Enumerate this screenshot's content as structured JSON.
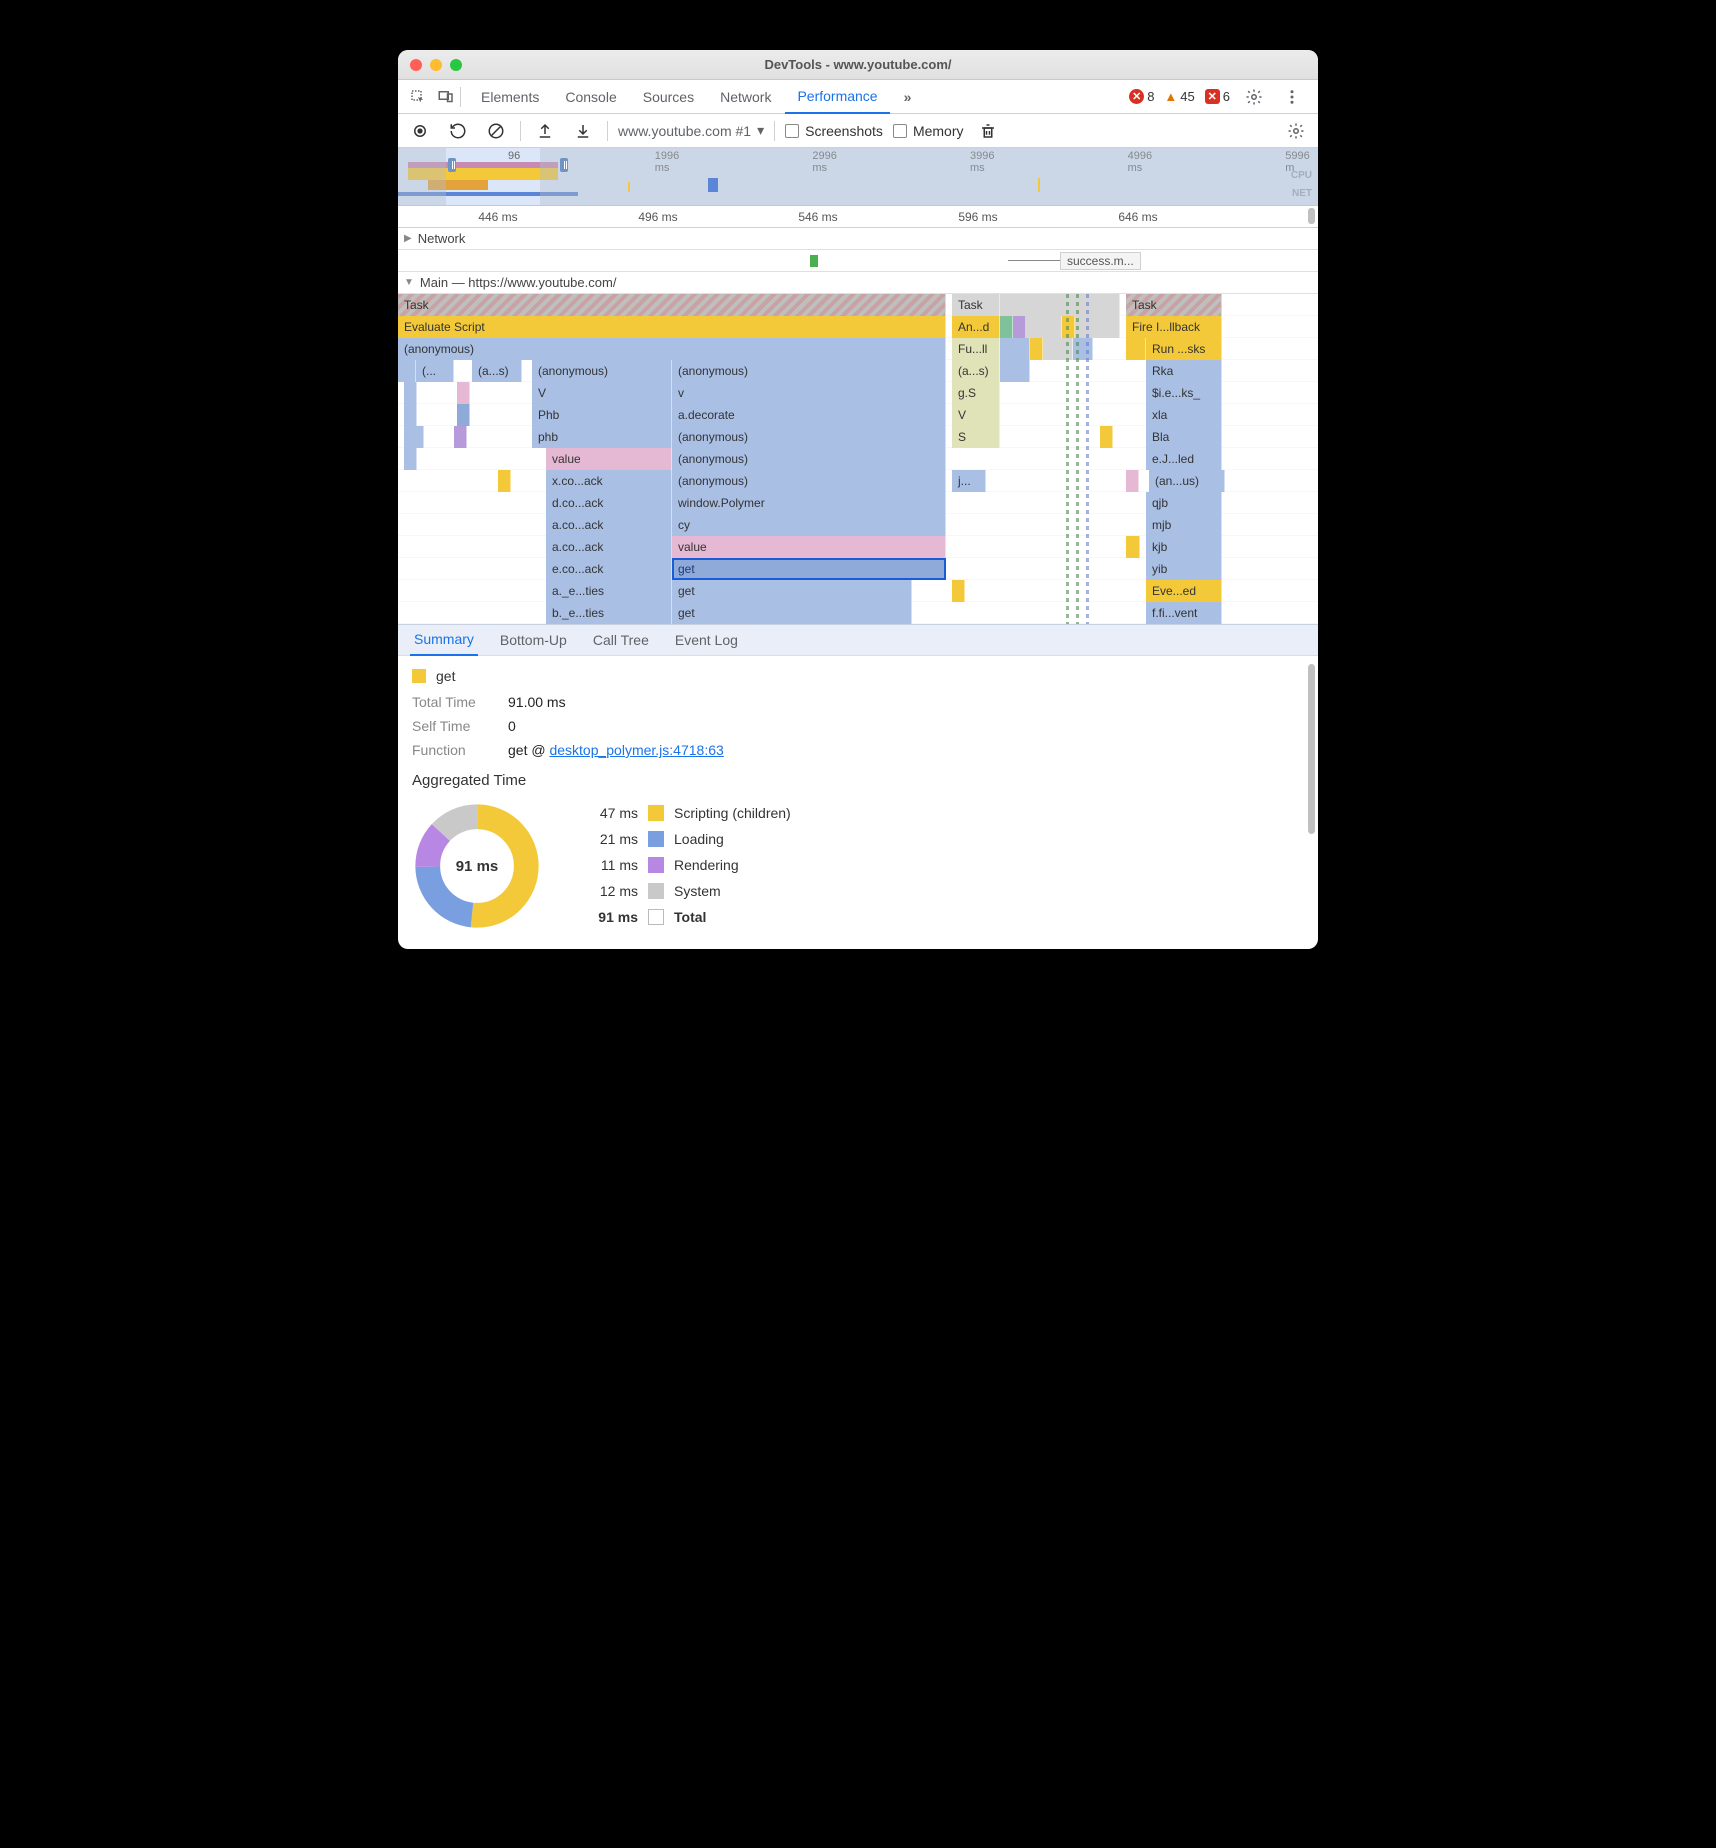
{
  "window": {
    "title": "DevTools - www.youtube.com/"
  },
  "mainTabs": {
    "items": [
      "Elements",
      "Console",
      "Sources",
      "Network",
      "Performance"
    ],
    "activeIndex": 4,
    "overflow": "»"
  },
  "statusBadges": {
    "errors": "8",
    "warnings": "45",
    "issues": "6"
  },
  "subToolbar": {
    "recording": "www.youtube.com #1",
    "screenshots": "Screenshots",
    "memory": "Memory"
  },
  "overview": {
    "ticks": [
      "96 ms",
      "1996 ms",
      "2996 ms",
      "3996 ms",
      "4996 ms",
      "5996 m"
    ],
    "cpu": "CPU",
    "net": "NET"
  },
  "ruler": {
    "ticks": [
      "446 ms",
      "496 ms",
      "546 ms",
      "596 ms",
      "646 ms"
    ]
  },
  "tracks": {
    "network": "Network",
    "networkChip": "success.m...",
    "main": "Main — https://www.youtube.com/"
  },
  "flame": {
    "col1": {
      "r0": "Task",
      "r1": "Evaluate Script",
      "r2": "(anonymous)",
      "r3a": "(...",
      "r3b": "(a...s)",
      "r3c": "(anonymous)",
      "r3d": "(anonymous)",
      "r4a": "V",
      "r4b": "v",
      "r5a": "Phb",
      "r5b": "a.decorate",
      "r6a": "phb",
      "r6b": "(anonymous)",
      "r7a": "value",
      "r7b": "(anonymous)",
      "r8a": "x.co...ack",
      "r8b": "(anonymous)",
      "r9a": "d.co...ack",
      "r9b": "window.Polymer",
      "r10a": "a.co...ack",
      "r10b": "cy",
      "r11a": "a.co...ack",
      "r11b": "value",
      "r12a": "e.co...ack",
      "r12b": "get",
      "r13a": "a._e...ties",
      "r13b": "get",
      "r14a": "b._e...ties",
      "r14b": "get"
    },
    "col2": {
      "r0": "Task",
      "r1": "An...d",
      "r2": "Fu...ll",
      "r3": "(a...s)",
      "r4": "g.S",
      "r5": "V",
      "r6": "S",
      "r8": "j..."
    },
    "col3": {
      "r0": "Task",
      "r1": "Fire I...llback",
      "r2": "Run ...sks",
      "r3": "Rka",
      "r4": "$i.e...ks_",
      "r5": "xla",
      "r6": "Bla",
      "r7": "e.J...led",
      "r8": "(an...us)",
      "r9": "qjb",
      "r10": "mjb",
      "r11": "kjb",
      "r12": "yib",
      "r13": "Eve...ed",
      "r14": "f.fi...vent"
    }
  },
  "bottomTabs": {
    "items": [
      "Summary",
      "Bottom-Up",
      "Call Tree",
      "Event Log"
    ],
    "activeIndex": 0
  },
  "summary": {
    "fnName": "get",
    "totalTimeLabel": "Total Time",
    "totalTime": "91.00 ms",
    "selfTimeLabel": "Self Time",
    "selfTime": "0",
    "functionLabel": "Function",
    "functionPrefix": "get @ ",
    "functionLink": "desktop_polymer.js:4718:63",
    "aggTitle": "Aggregated Time",
    "donutCenter": "91 ms",
    "legend": [
      {
        "ms": "47 ms",
        "label": "Scripting (children)",
        "color": "#f4c939"
      },
      {
        "ms": "21 ms",
        "label": "Loading",
        "color": "#7a9fe0"
      },
      {
        "ms": "11 ms",
        "label": "Rendering",
        "color": "#b887e3"
      },
      {
        "ms": "12 ms",
        "label": "System",
        "color": "#c9c9c9"
      }
    ],
    "totalRow": {
      "ms": "91 ms",
      "label": "Total"
    }
  },
  "chart_data": {
    "type": "pie",
    "title": "Aggregated Time",
    "series": [
      {
        "name": "Scripting (children)",
        "value": 47,
        "unit": "ms",
        "color": "#f4c939"
      },
      {
        "name": "Loading",
        "value": 21,
        "unit": "ms",
        "color": "#7a9fe0"
      },
      {
        "name": "Rendering",
        "value": 11,
        "unit": "ms",
        "color": "#b887e3"
      },
      {
        "name": "System",
        "value": 12,
        "unit": "ms",
        "color": "#c9c9c9"
      }
    ],
    "total": {
      "value": 91,
      "unit": "ms"
    }
  }
}
